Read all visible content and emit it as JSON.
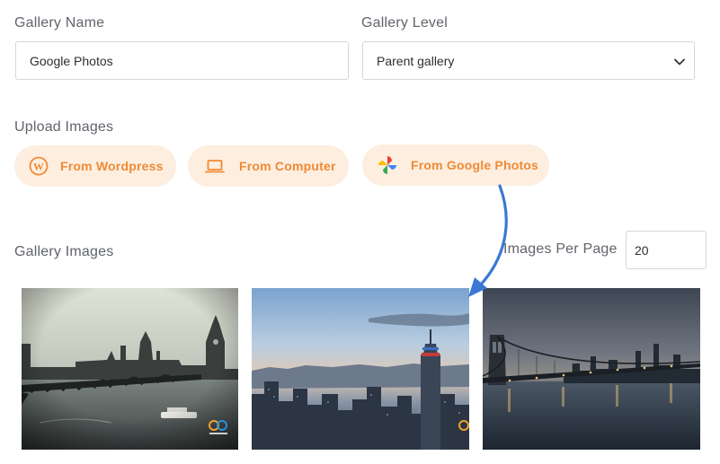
{
  "form": {
    "gallery_name_label": "Gallery Name",
    "gallery_name_value": "Google Photos",
    "gallery_level_label": "Gallery Level",
    "gallery_level_value": "Parent gallery",
    "upload_label": "Upload Images",
    "gallery_images_label": "Gallery Images",
    "images_per_page_label": "Images Per Page",
    "images_per_page_value": "20"
  },
  "upload_buttons": [
    {
      "label": "From Wordpress",
      "icon": "wordpress-icon"
    },
    {
      "label": "From Computer",
      "icon": "laptop-icon"
    },
    {
      "label": "From Google Photos",
      "icon": "google-photos-icon"
    }
  ],
  "thumbnails": [
    {
      "subject": "London Westminster Thames",
      "icon": "logo-badge-icon"
    },
    {
      "subject": "New York skyline Empire State Building",
      "icon": "logo-badge-icon"
    },
    {
      "subject": "Brooklyn Bridge at dusk"
    }
  ],
  "colors": {
    "accent": "#ef8a35",
    "button_bg": "#fdeee0",
    "arrow": "#3a78d4"
  }
}
